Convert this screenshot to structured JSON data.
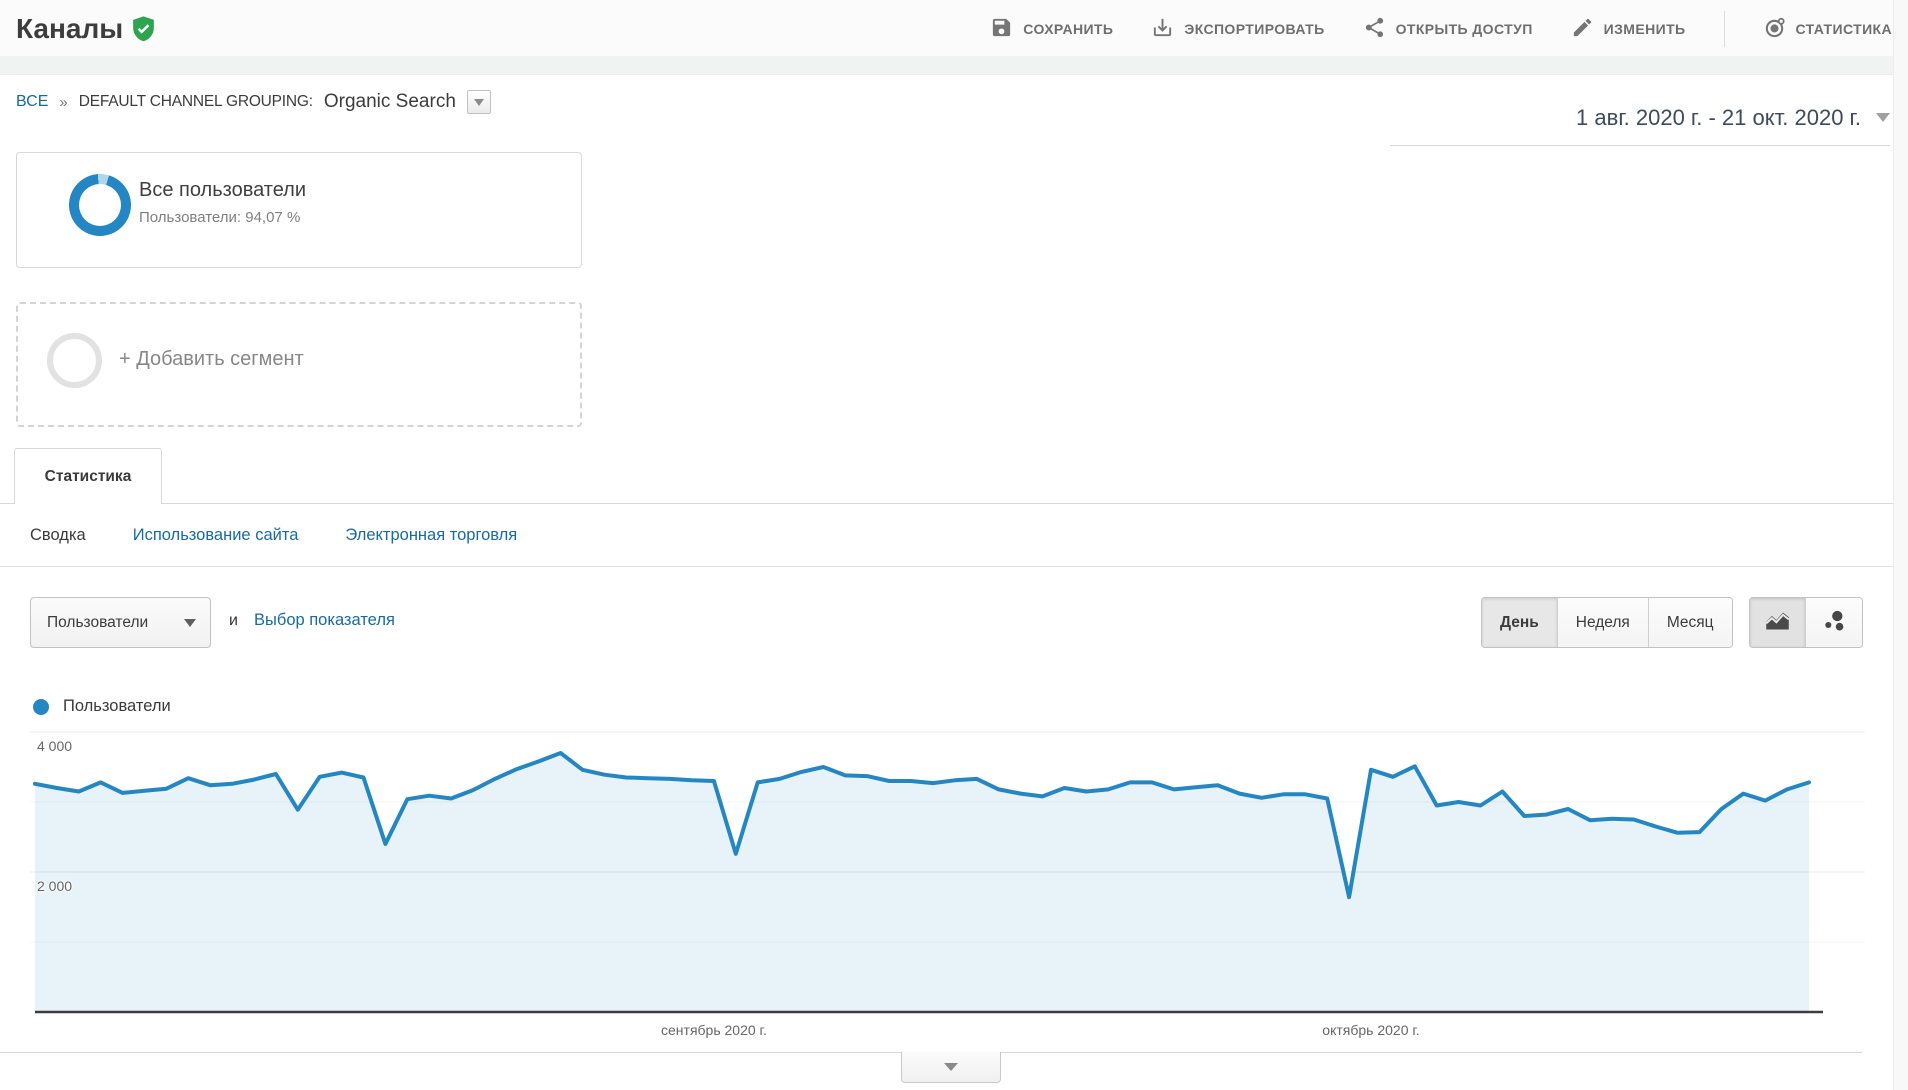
{
  "header": {
    "title": "Каналы",
    "toolbar": [
      {
        "label": "СОХРАНИТЬ",
        "icon": "save-icon"
      },
      {
        "label": "ЭКСПОРТИРОВАТЬ",
        "icon": "export-icon"
      },
      {
        "label": "ОТКРЫТЬ ДОСТУП",
        "icon": "share-icon"
      },
      {
        "label": "ИЗМЕНИТЬ",
        "icon": "edit-icon"
      },
      {
        "label": "СТАТИСТИКА",
        "icon": "insights-icon"
      }
    ]
  },
  "breadcrumb": {
    "all": "ВСЕ",
    "separator": "»",
    "dimension": "DEFAULT CHANNEL GROUPING:",
    "value": "Organic Search"
  },
  "date_range": {
    "label": "1 авг. 2020 г. - 21 окт. 2020 г."
  },
  "segments": {
    "active": {
      "title": "Все пользователи",
      "subtitle": "Пользователи: 94,07 %",
      "donut_color": "#2586c4",
      "donut_rest_color": "#aed6ec"
    },
    "add": {
      "label": "+ Добавить сегмент"
    }
  },
  "tabs": {
    "main": "Статистика",
    "sub": [
      "Сводка",
      "Использование сайта",
      "Электронная торговля"
    ]
  },
  "controls": {
    "metric": "Пользователи",
    "conj": "и",
    "metric_link": "Выбор показателя",
    "granularity": [
      "День",
      "Неделя",
      "Месяц"
    ],
    "active_granularity": "День"
  },
  "chart_data": {
    "type": "area",
    "title": "",
    "x_range": "1 авг. 2020 г. - 21 окт. 2020 г.",
    "series": [
      {
        "name": "Пользователи",
        "color": "#2586c4",
        "fill_color": "rgba(37,134,196,0.11)",
        "values": [
          3260,
          3200,
          3150,
          3280,
          3130,
          3160,
          3190,
          3340,
          3240,
          3260,
          3320,
          3400,
          2890,
          3360,
          3420,
          3350,
          2400,
          3040,
          3090,
          3050,
          3170,
          3330,
          3470,
          3580,
          3700,
          3460,
          3390,
          3350,
          3340,
          3330,
          3310,
          3300,
          2260,
          3280,
          3330,
          3430,
          3500,
          3380,
          3370,
          3300,
          3300,
          3270,
          3310,
          3330,
          3180,
          3120,
          3080,
          3200,
          3150,
          3180,
          3280,
          3280,
          3180,
          3210,
          3240,
          3120,
          3060,
          3110,
          3110,
          3050,
          1640,
          3460,
          3360,
          3510,
          2950,
          3000,
          2950,
          3150,
          2800,
          2820,
          2900,
          2740,
          2760,
          2750,
          2650,
          2560,
          2570,
          2900,
          3120,
          3020,
          3180,
          3280
        ]
      }
    ],
    "x": {
      "ticks": [
        {
          "label": "сентябрь 2020 г.",
          "day_index": 31
        },
        {
          "label": "октябрь 2020 г.",
          "day_index": 61
        }
      ]
    },
    "y": {
      "min": 0,
      "max": 4000,
      "ticks": [
        {
          "label": "4 000",
          "value": 4000
        },
        {
          "label": "2 000",
          "value": 2000
        }
      ],
      "minor_grid": [
        3000,
        1000
      ]
    },
    "grid": true,
    "legend_position": "top-left"
  }
}
